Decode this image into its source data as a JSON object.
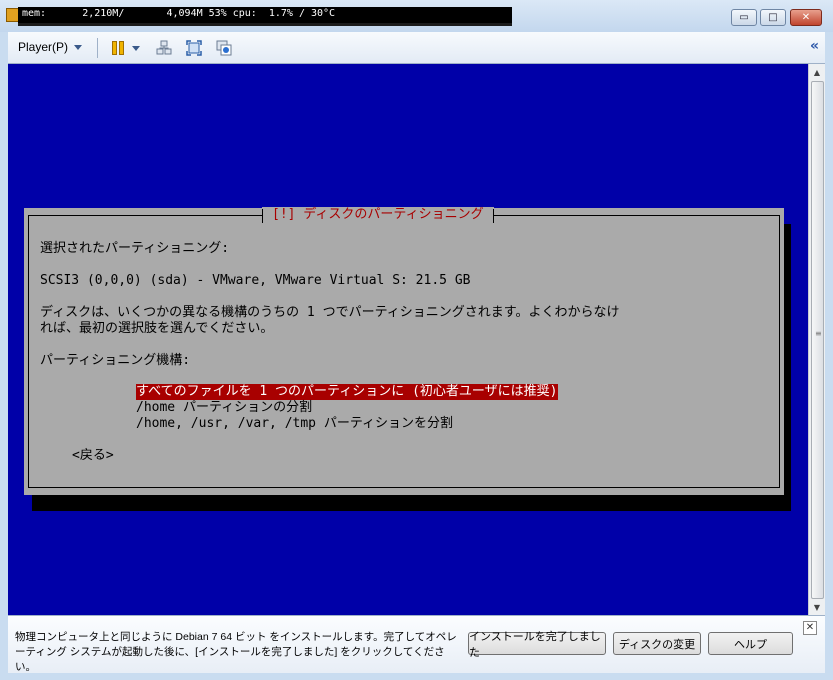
{
  "titlebar": {
    "perf_text": "mem:      2,210M/       4,094M 53% cpu:  1.7% / 30°C",
    "minimize": "▭",
    "maximize": "□",
    "close": "✕"
  },
  "toolbar": {
    "player_menu": "Player(P)",
    "collapse": "«"
  },
  "dialog": {
    "title": "[!] ディスクのパーティショニング",
    "line1": "選択されたパーティショニング:",
    "disk": "SCSI3 (0,0,0) (sda) - VMware, VMware Virtual S: 21.5 GB",
    "desc1": "ディスクは、いくつかの異なる機構のうちの 1 つでパーティショニングされます。よくわからなけ",
    "desc2": "れば、最初の選択肢を選んでください。",
    "scheme_label": "パーティショニング機構:",
    "options": [
      "すべてのファイルを 1 つのパーティションに (初心者ユーザには推奨)",
      "/home パーティションの分割",
      "/home, /usr, /var, /tmp パーティションを分割"
    ],
    "selected_index": 0,
    "back": "<戻る>"
  },
  "hintbar": {
    "text": "物理コンピュータ上と同じように Debian 7 64 ビット をインストールします。完了してオペレーティング システムが起動した後に、[インストールを完了しました] をクリックしてください。",
    "buttons": {
      "finish": "インストールを完了しました",
      "change_disk": "ディスクの変更",
      "help": "ヘルプ"
    },
    "close": "✕"
  }
}
